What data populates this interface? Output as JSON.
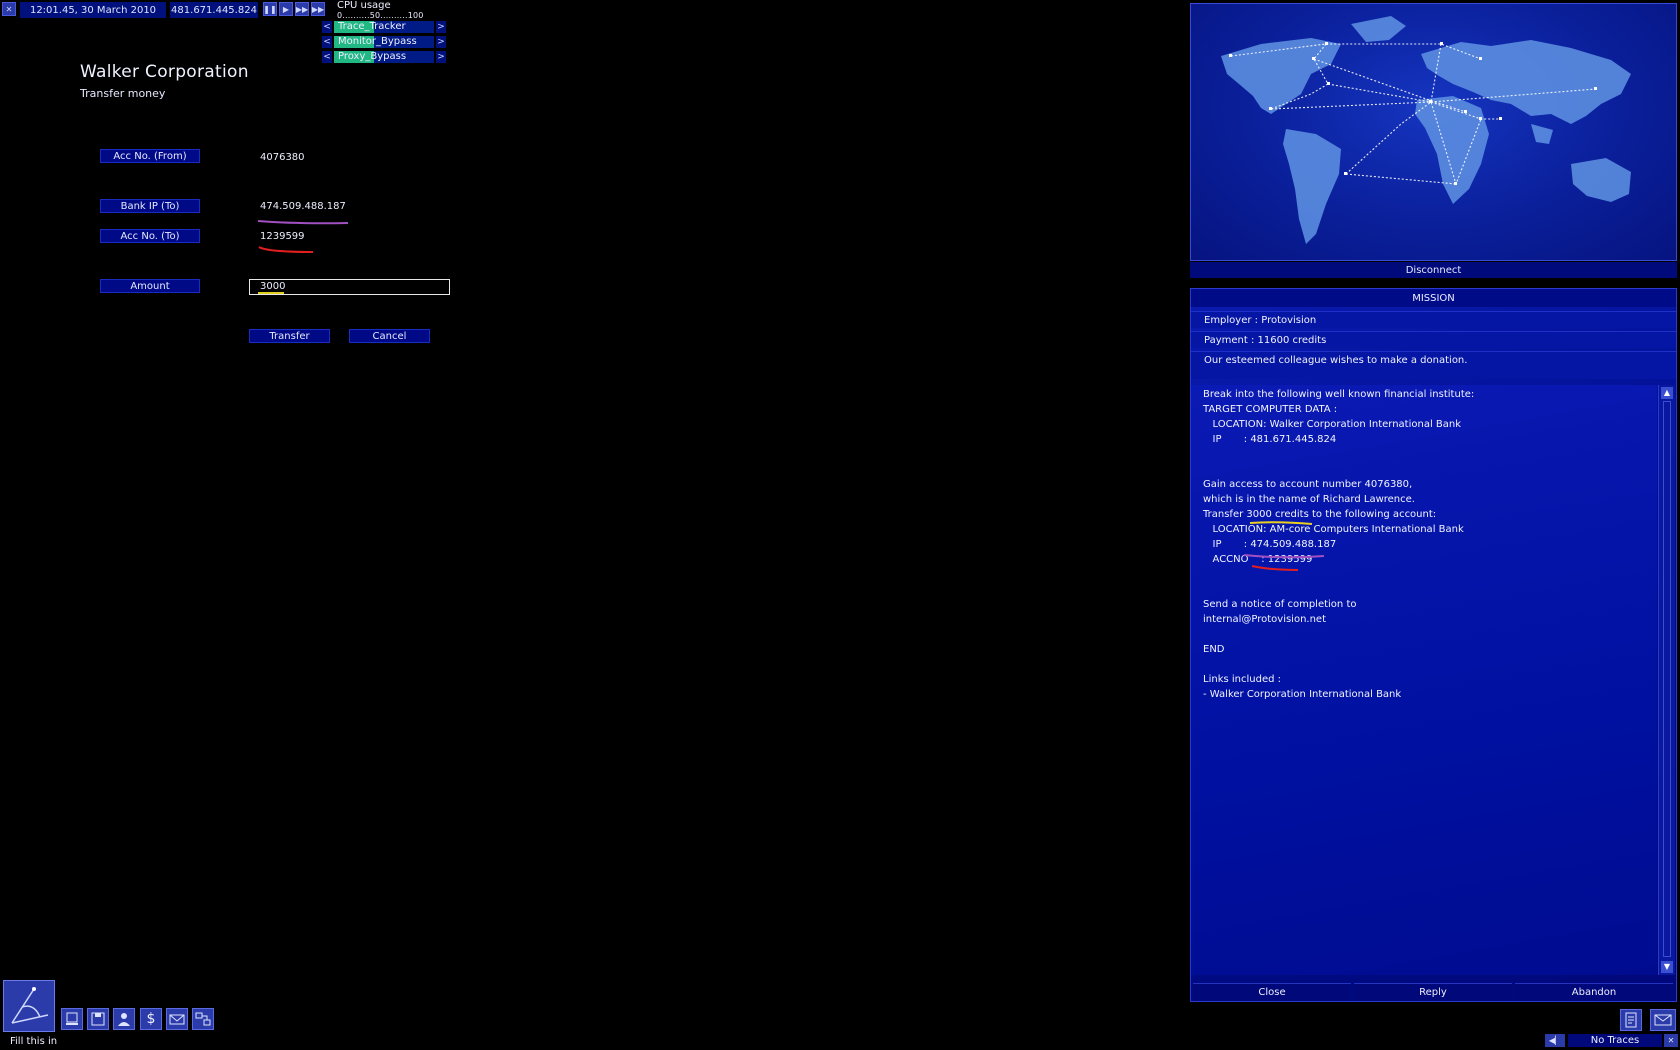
{
  "topbar": {
    "clock": "12:01.45, 30 March 2010",
    "ip": "481.671.445.824",
    "cpu_label": "CPU usage",
    "cpu_scale": "0..........50..........100",
    "programs": [
      {
        "label": "Trace_Tracker",
        "fill": 0.4
      },
      {
        "label": "Monitor_Bypass",
        "fill": 0.4
      },
      {
        "label": "Proxy_Bypass",
        "fill": 0.4
      }
    ]
  },
  "page": {
    "title": "Walker Corporation",
    "subtitle": "Transfer money"
  },
  "form": {
    "acc_from_label": "Acc No. (From)",
    "acc_from_value": "4076380",
    "bank_ip_label": "Bank IP (To)",
    "bank_ip_value": "474.509.488.187",
    "acc_to_label": "Acc No. (To)",
    "acc_to_value": "1239599",
    "amount_label": "Amount",
    "amount_value": "3000",
    "transfer_label": "Transfer",
    "cancel_label": "Cancel"
  },
  "map": {
    "disconnect_label": "Disconnect"
  },
  "mission": {
    "header": "MISSION",
    "employer": "Employer : Protovision",
    "payment": "Payment : 11600 credits",
    "summary": "Our esteemed colleague wishes to make a donation.",
    "body": [
      "Break into the following well known financial institute:",
      "TARGET COMPUTER DATA :",
      "   LOCATION: Walker Corporation International Bank",
      "   IP       : 481.671.445.824",
      "",
      "",
      "Gain access to account number 4076380,",
      "which is in the name of Richard Lawrence.",
      "Transfer 3000 credits to the following account:",
      "   LOCATION: AM-core Computers International Bank",
      "   IP       : 474.509.488.187",
      "   ACCNO    : 1239599",
      "",
      "",
      "Send a notice of completion to",
      "internal@Protovision.net",
      "",
      "END",
      "",
      "Links included :",
      "- Walker Corporation International Bank"
    ],
    "close_label": "Close",
    "reply_label": "Reply",
    "abandon_label": "Abandon"
  },
  "status": {
    "hint": "Fill this in",
    "traces": "No Traces"
  },
  "icons": [
    "gateway-icon",
    "computer-icon",
    "save-icon",
    "person-icon",
    "finance-icon",
    "email-icon",
    "connections-icon"
  ]
}
